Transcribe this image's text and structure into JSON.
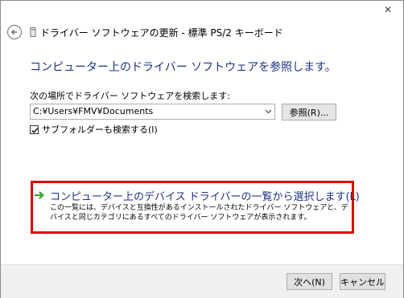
{
  "window": {
    "title": "ドライバー ソフトウェアの更新 - 標準 PS/2 キーボード",
    "close_label": "✕"
  },
  "heading": "コンピューター上のドライバー ソフトウェアを参照します。",
  "search": {
    "label": "次の場所でドライバー ソフトウェアを検索します:",
    "path_value": "C:¥Users¥FMV¥Documents",
    "browse_label": "参照(R)...",
    "subfolder_label": "サブフォルダーも検索する(I)",
    "subfolder_checked": true
  },
  "option": {
    "title": "コンピューター上のデバイス ドライバーの一覧から選択します(L)",
    "description": "この一覧には、デバイスと互換性があるインストールされたドライバー ソフトウェアと、デバイスと同じカテゴリにあるすべてのドライバー ソフトウェアが表示されます。",
    "highlight_color": "#e00000"
  },
  "footer": {
    "next_label": "次へ(N)",
    "cancel_label": "キャンセル"
  },
  "colors": {
    "heading": "#1e3287",
    "arrow_green": "#3aa53a"
  },
  "icons": {
    "back": "back-arrow-icon",
    "option": "green-arrow-icon"
  }
}
